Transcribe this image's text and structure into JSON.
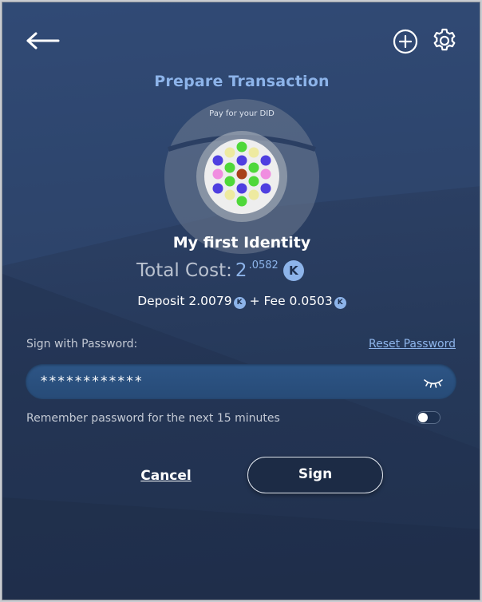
{
  "header": {
    "title": "Prepare Transaction",
    "back_icon": "arrow-left-icon",
    "add_icon": "plus-circle-icon",
    "settings_icon": "gear-icon"
  },
  "identity": {
    "pay_label": "Pay for your DID",
    "name": "My first Identity",
    "avatar_icon": "identicon-avatar"
  },
  "cost": {
    "total_label": "Total Cost:",
    "total_integer": "2",
    "total_decimal": ".0582",
    "deposit_text": "Deposit 2.0079",
    "fee_text": "+ Fee 0.0503",
    "currency_icon": "kilt-coin-icon"
  },
  "password": {
    "label": "Sign with Password:",
    "reset_label": "Reset Password",
    "value": "************",
    "eye_icon": "eye-closed-icon",
    "remember_label": "Remember password for the next 15 minutes",
    "remember_enabled": false
  },
  "actions": {
    "cancel_label": "Cancel",
    "sign_label": "Sign"
  },
  "colors": {
    "accent": "#8db4ea",
    "background": "#2b3f63",
    "field": "#2d5586",
    "button_dark": "#1c2b45"
  }
}
